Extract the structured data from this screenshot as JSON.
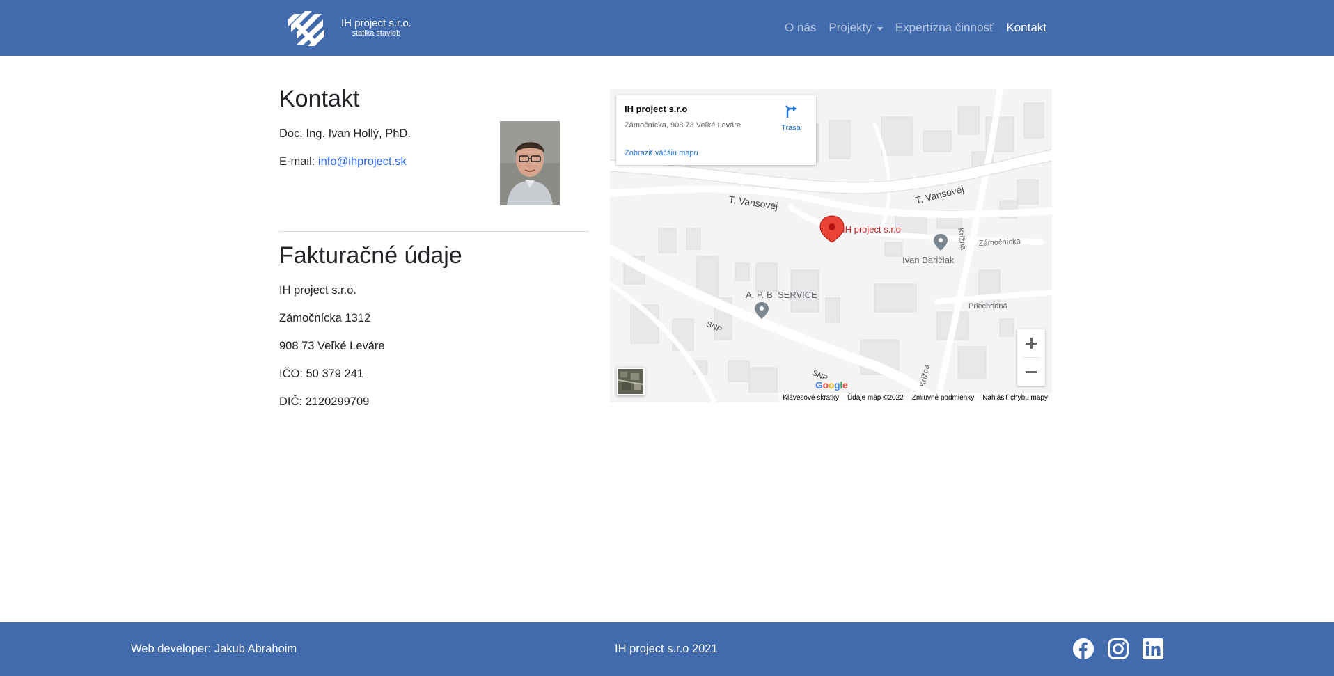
{
  "header": {
    "brand_name": "IH project s.r.o.",
    "brand_sub": "statika stavieb",
    "nav": [
      {
        "label": "O nás"
      },
      {
        "label": "Projekty"
      },
      {
        "label": "Expertízna činnosť"
      },
      {
        "label": "Kontakt"
      }
    ]
  },
  "contact": {
    "title": "Kontakt",
    "name": "Doc. Ing. Ivan Hollý, PhD.",
    "email_label": "E-mail: ",
    "email": "info@ihproject.sk"
  },
  "billing": {
    "title": "Fakturačné údaje",
    "company": "IH project s.r.o.",
    "street": "Zámočnícka 1312",
    "city": "908 73 Veľké Leváre",
    "ico": "IČO: 50 379 241",
    "dic": "DIČ: 2120299709"
  },
  "map": {
    "place_name": "IH project s.r.o",
    "place_address": "Zámočnícka, 908 73 Veľké Leváre",
    "larger_map": "Zobraziť väčšiu mapu",
    "directions": "Trasa",
    "labels": {
      "street1": "T. Vansovej",
      "street2": "T. Vansovej",
      "street_krizna": "Krížna",
      "street_krizna2": "Krížna",
      "street_zamocnicka": "Zámočnícka",
      "street_priechodna": "Priechodná",
      "street_snp": "SNP",
      "street_snp2": "SNP",
      "marker": "IH project s.r.o",
      "poi1": "Ivan Baričiak",
      "poi2": "A. P. B. SERVICE"
    },
    "footer": {
      "shortcuts": "Klávesové skratky",
      "data": "Údaje máp ©2022",
      "terms": "Zmluvné podmienky",
      "report": "Nahlásiť chybu mapy"
    },
    "google": "Google"
  },
  "footer": {
    "developer": "Web developer: Jakub Abrahoim",
    "copyright": "IH project s.r.o 2021"
  },
  "colors": {
    "primary": "#426bad",
    "link": "#2563eb",
    "marker": "#ea4335"
  },
  "icons": [
    "logo-icon",
    "directions-icon",
    "zoom-in-icon",
    "zoom-out-icon",
    "facebook-icon",
    "instagram-icon",
    "linkedin-icon",
    "map-marker-icon"
  ]
}
